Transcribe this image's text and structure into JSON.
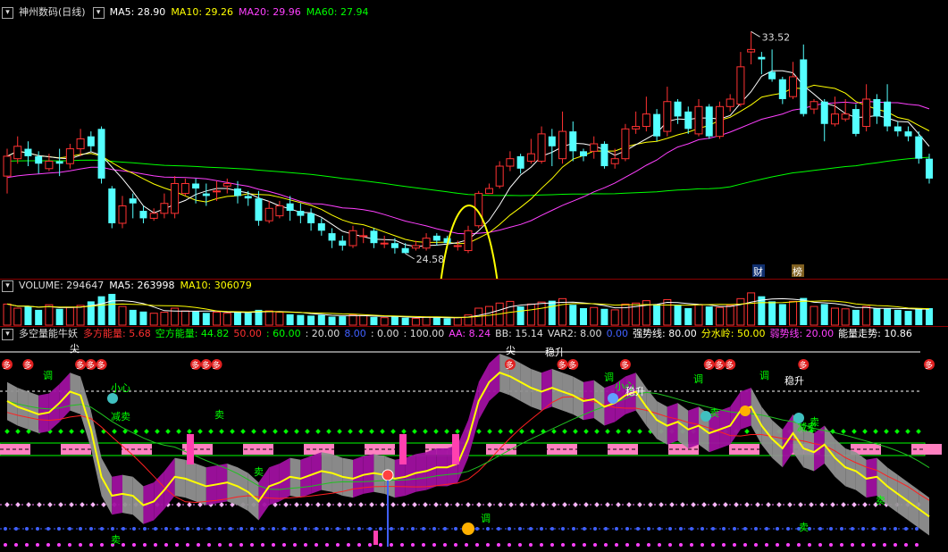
{
  "price_header": {
    "title": "神州数码(日线)",
    "ma5": "MA5: 28.90",
    "ma10": "MA10: 29.26",
    "ma20": "MA20: 29.96",
    "ma60": "MA60: 27.94"
  },
  "volume_header": {
    "volume": "VOLUME: 294647",
    "ma5": "MA5: 263998",
    "ma10": "MA10: 306079"
  },
  "indicator_header": {
    "name": "多空量能牛妖",
    "items": [
      {
        "text": "多方能量: 5.68",
        "color": "#ff3030"
      },
      {
        "text": "空方能量: 44.82",
        "color": "#00ff00"
      },
      {
        "text": "50.00",
        "color": "#ff3030"
      },
      {
        "text": ": 60.00",
        "color": "#00ff00"
      },
      {
        "text": ": 20.00",
        "color": "#dddddd"
      },
      {
        "text": "8.00",
        "color": "#4060ff"
      },
      {
        "text": ": 0.00",
        "color": "#dddddd"
      },
      {
        "text": ": 100.00",
        "color": "#dddddd"
      },
      {
        "text": "AA: 8.24",
        "color": "#ff40ff"
      },
      {
        "text": "BB: 15.14",
        "color": "#dddddd"
      },
      {
        "text": "VAR2: 8.00",
        "color": "#dddddd"
      },
      {
        "text": "0.00",
        "color": "#4060ff"
      },
      {
        "text": "强势线: 80.00",
        "color": "#ffffff"
      },
      {
        "text": "分水岭: 50.00",
        "color": "#ffff00"
      },
      {
        "text": "弱势线: 20.00",
        "color": "#ff40ff"
      },
      {
        "text": "能量走势: 10.86",
        "color": "#ffffff"
      }
    ]
  },
  "annotations": {
    "high": "33.52",
    "low": "24.58",
    "badge_cai": "财",
    "badge_bang": "榜"
  },
  "signal_labels": {
    "duo": "多",
    "tiao": "调",
    "xiaoxin": "小心",
    "mai_sell": "卖",
    "wenshen": "稳升",
    "jian": "尖",
    "jia_mai": "减卖",
    "jia_mai2": "减",
    "jiashou": "卖",
    "ji": "买"
  },
  "colors": {
    "up": "#ff3232",
    "down": "#54ffff",
    "ma5": "#ffffff",
    "ma10": "#ffff00",
    "ma20": "#ff40ff",
    "ma60": "#00ff00",
    "divider": "#8a0000"
  },
  "chart_data": {
    "type": "candlestick",
    "ylim": [
      24.0,
      34.0
    ],
    "candles": [
      [
        27.7,
        28.5,
        27.0,
        28.8
      ],
      [
        28.4,
        28.9,
        28.2,
        29.3
      ],
      [
        28.8,
        28.5,
        28.1,
        29.1
      ],
      [
        28.5,
        28.2,
        27.8,
        28.7
      ],
      [
        28.0,
        28.3,
        27.9,
        28.6
      ],
      [
        28.3,
        28.2,
        27.7,
        28.8
      ],
      [
        28.2,
        28.8,
        28.0,
        29.0
      ],
      [
        28.8,
        29.2,
        28.5,
        29.6
      ],
      [
        29.3,
        28.9,
        28.7,
        29.5
      ],
      [
        29.6,
        27.6,
        27.4,
        29.7
      ],
      [
        27.2,
        25.8,
        25.6,
        27.3
      ],
      [
        25.8,
        26.5,
        25.6,
        26.9
      ],
      [
        26.8,
        26.6,
        26.0,
        27.0
      ],
      [
        26.3,
        26.0,
        25.8,
        26.5
      ],
      [
        26.0,
        26.2,
        25.9,
        26.4
      ],
      [
        26.2,
        26.6,
        26.0,
        27.0
      ],
      [
        26.2,
        27.4,
        26.0,
        27.7
      ],
      [
        27.0,
        27.4,
        26.9,
        27.6
      ],
      [
        27.4,
        27.2,
        26.6,
        27.6
      ],
      [
        27.0,
        26.9,
        26.5,
        27.4
      ],
      [
        27.1,
        27.1,
        26.7,
        27.5
      ],
      [
        27.3,
        27.4,
        27.0,
        27.6
      ],
      [
        27.2,
        26.9,
        26.6,
        27.5
      ],
      [
        26.9,
        26.8,
        26.5,
        27.1
      ],
      [
        26.8,
        25.9,
        25.7,
        27.1
      ],
      [
        25.9,
        26.4,
        25.8,
        26.7
      ],
      [
        26.1,
        26.5,
        26.0,
        26.7
      ],
      [
        26.6,
        26.3,
        25.9,
        26.9
      ],
      [
        26.3,
        26.1,
        25.8,
        26.6
      ],
      [
        26.2,
        25.8,
        25.5,
        26.4
      ],
      [
        25.8,
        25.5,
        25.3,
        26.0
      ],
      [
        25.4,
        25.1,
        24.8,
        25.6
      ],
      [
        25.1,
        24.9,
        24.7,
        25.3
      ],
      [
        24.9,
        25.5,
        24.8,
        25.7
      ],
      [
        25.3,
        25.3,
        25.0,
        25.6
      ],
      [
        25.5,
        25.0,
        24.8,
        25.6
      ],
      [
        25.0,
        25.0,
        24.8,
        25.3
      ],
      [
        25.0,
        24.8,
        24.58,
        25.2
      ],
      [
        24.8,
        24.6,
        24.58,
        25.0
      ],
      [
        24.8,
        24.9,
        24.7,
        25.1
      ],
      [
        24.8,
        25.2,
        24.7,
        25.4
      ],
      [
        25.3,
        25.1,
        24.9,
        25.4
      ],
      [
        25.2,
        25.0,
        24.8,
        25.3
      ],
      [
        24.9,
        24.9,
        24.7,
        25.1
      ],
      [
        24.7,
        25.5,
        24.6,
        25.7
      ],
      [
        25.7,
        27.0,
        25.6,
        27.1
      ],
      [
        27.0,
        27.2,
        27.0,
        27.4
      ],
      [
        27.3,
        28.1,
        27.2,
        28.3
      ],
      [
        28.1,
        28.4,
        27.9,
        28.7
      ],
      [
        28.5,
        28.0,
        27.8,
        28.6
      ],
      [
        28.3,
        28.6,
        28.2,
        29.2
      ],
      [
        28.3,
        29.4,
        28.2,
        29.7
      ],
      [
        29.3,
        28.9,
        28.1,
        29.6
      ],
      [
        28.4,
        29.5,
        28.2,
        30.3
      ],
      [
        29.5,
        28.7,
        28.3,
        29.9
      ],
      [
        28.7,
        28.5,
        28.3,
        28.8
      ],
      [
        28.7,
        29.0,
        28.4,
        29.3
      ],
      [
        29.0,
        28.1,
        28.0,
        29.1
      ],
      [
        28.2,
        28.4,
        28.0,
        28.8
      ],
      [
        28.4,
        29.6,
        28.3,
        29.8
      ],
      [
        29.6,
        29.7,
        29.4,
        30.3
      ],
      [
        29.7,
        30.2,
        29.5,
        30.9
      ],
      [
        30.2,
        29.3,
        29.1,
        30.4
      ],
      [
        29.5,
        30.7,
        29.3,
        31.3
      ],
      [
        30.7,
        30.1,
        29.8,
        30.8
      ],
      [
        30.3,
        29.6,
        29.4,
        30.5
      ],
      [
        29.4,
        30.5,
        29.3,
        30.8
      ],
      [
        30.5,
        29.3,
        29.2,
        30.6
      ],
      [
        29.3,
        30.5,
        29.2,
        30.7
      ],
      [
        30.5,
        30.8,
        30.3,
        31.0
      ],
      [
        30.6,
        32.1,
        30.5,
        32.7
      ],
      [
        32.7,
        32.8,
        32.2,
        33.52
      ],
      [
        32.5,
        32.4,
        31.8,
        32.7
      ],
      [
        31.9,
        31.6,
        31.5,
        32.8
      ],
      [
        31.6,
        30.8,
        30.6,
        31.7
      ],
      [
        30.9,
        31.7,
        30.8,
        32.3
      ],
      [
        32.4,
        30.2,
        30.1,
        33.0
      ],
      [
        30.4,
        30.7,
        30.2,
        30.8
      ],
      [
        30.7,
        29.8,
        29.1,
        30.8
      ],
      [
        29.8,
        30.2,
        29.7,
        30.9
      ],
      [
        30.0,
        30.2,
        29.9,
        30.8
      ],
      [
        30.4,
        29.4,
        29.3,
        30.6
      ],
      [
        29.7,
        30.8,
        29.5,
        31.4
      ],
      [
        30.8,
        30.1,
        29.8,
        31.0
      ],
      [
        30.7,
        29.7,
        29.5,
        31.4
      ],
      [
        29.7,
        29.5,
        29.3,
        29.9
      ],
      [
        29.5,
        29.3,
        29.1,
        29.7
      ],
      [
        29.3,
        28.4,
        28.2,
        29.5
      ],
      [
        28.4,
        27.6,
        27.4,
        28.6
      ]
    ],
    "volume": [
      0.62,
      0.5,
      0.55,
      0.45,
      0.6,
      0.48,
      0.52,
      0.58,
      0.7,
      0.85,
      0.92,
      0.55,
      0.45,
      0.4,
      0.35,
      0.38,
      0.5,
      0.42,
      0.4,
      0.36,
      0.38,
      0.35,
      0.4,
      0.36,
      0.45,
      0.42,
      0.38,
      0.32,
      0.3,
      0.28,
      0.3,
      0.25,
      0.26,
      0.3,
      0.28,
      0.24,
      0.22,
      0.25,
      0.22,
      0.2,
      0.24,
      0.22,
      0.2,
      0.22,
      0.3,
      0.5,
      0.55,
      0.65,
      0.7,
      0.55,
      0.62,
      0.68,
      0.72,
      0.78,
      0.6,
      0.5,
      0.52,
      0.48,
      0.45,
      0.62,
      0.65,
      0.72,
      0.62,
      0.75,
      0.58,
      0.5,
      0.6,
      0.55,
      0.52,
      0.58,
      0.78,
      0.95,
      0.85,
      0.7,
      0.62,
      0.7,
      0.8,
      0.55,
      0.62,
      0.5,
      0.48,
      0.45,
      0.55,
      0.5,
      0.5,
      0.45,
      0.42,
      0.48,
      0.5
    ],
    "osc_yellow": [
      75,
      72,
      70,
      68,
      69,
      74,
      80,
      78,
      60,
      35,
      25,
      26,
      25,
      20,
      22,
      28,
      35,
      34,
      32,
      30,
      31,
      32,
      30,
      27,
      22,
      30,
      32,
      35,
      34,
      36,
      38,
      37,
      35,
      34,
      36,
      37,
      36,
      34,
      35,
      37,
      38,
      40,
      40,
      42,
      55,
      75,
      85,
      90,
      88,
      85,
      82,
      80,
      82,
      80,
      78,
      75,
      76,
      72,
      74,
      78,
      80,
      72,
      65,
      62,
      64,
      60,
      62,
      58,
      60,
      62,
      70,
      72,
      62,
      55,
      50,
      58,
      50,
      48,
      52,
      45,
      40,
      38,
      34,
      35,
      30,
      26,
      22,
      18,
      14
    ]
  }
}
